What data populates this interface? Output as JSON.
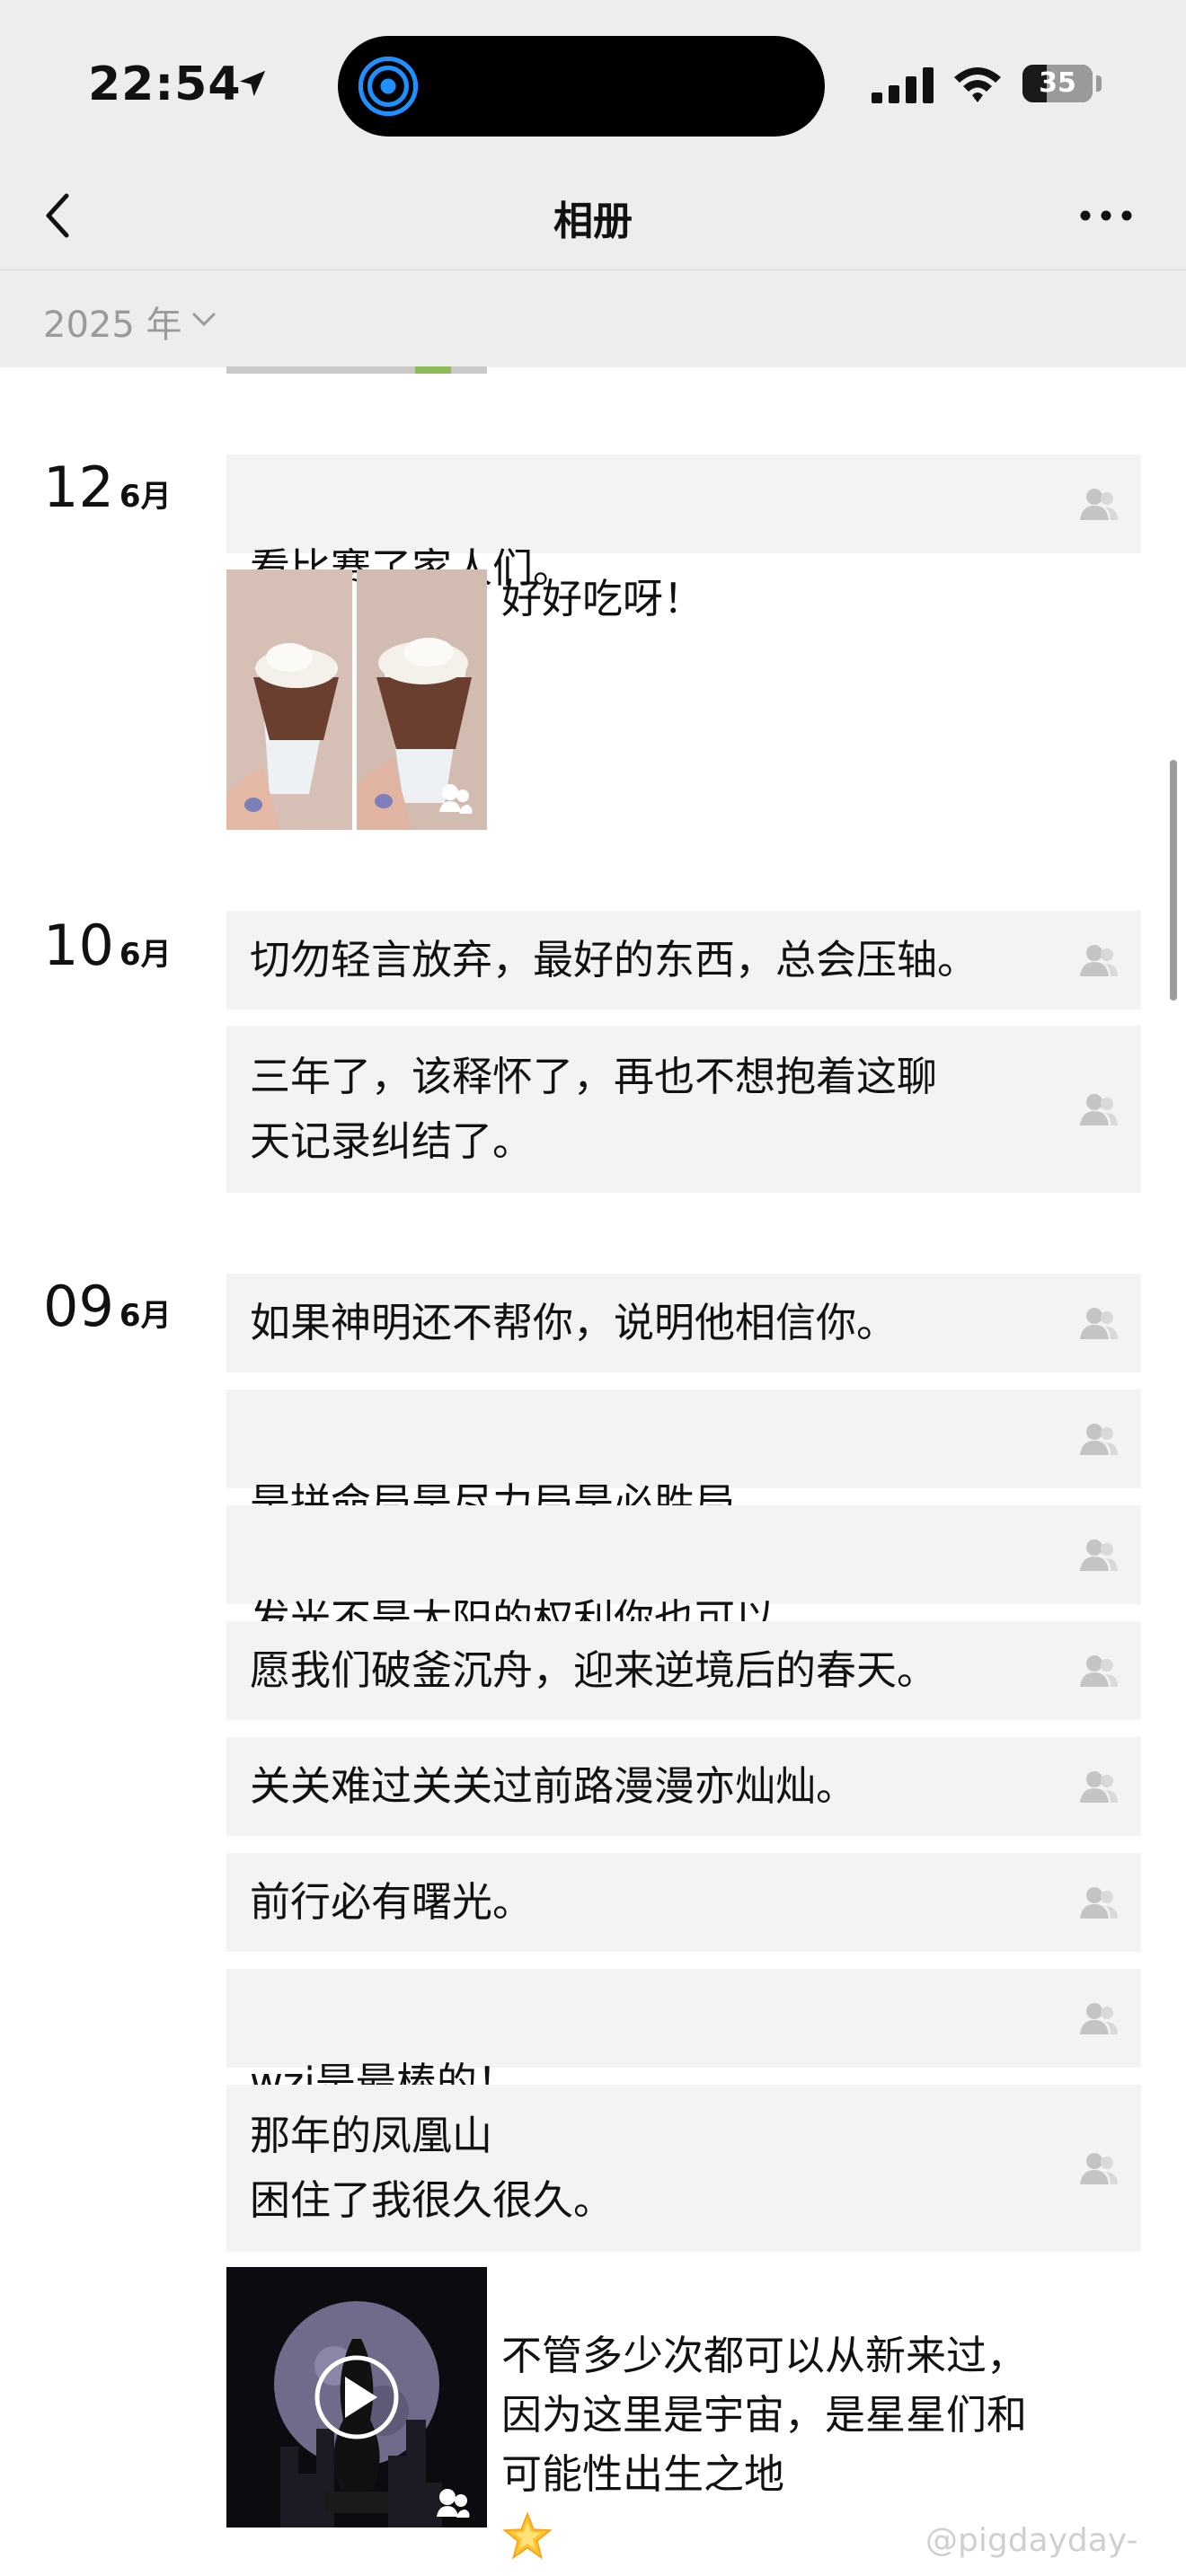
{
  "status_bar": {
    "time": "22:54",
    "battery": "35"
  },
  "nav": {
    "title": "相册"
  },
  "year_filter": {
    "label": "2025 年"
  },
  "days": [
    {
      "day": "12",
      "month": "6月",
      "posts": [
        {
          "text": "看比赛了家人们。"
        },
        {
          "caption": "好好吃呀！"
        }
      ]
    },
    {
      "day": "10",
      "month": "6月",
      "posts": [
        {
          "text": "切勿轻言放弃，最好的东西，总会压轴。"
        },
        {
          "text": "三年了，该释怀了，再也不想抱着这聊\n天记录纠结了。"
        }
      ]
    },
    {
      "day": "09",
      "month": "6月",
      "posts": [
        {
          "text": "如果神明还不帮你，说明他相信你。"
        },
        {
          "text": "是拼命局是尽力局是必胜局"
        },
        {
          "text": "发光不是太阳的权利你也可以"
        },
        {
          "text": "愿我们破釜沉舟，迎来逆境后的春天。"
        },
        {
          "text": "关关难过关关过前路漫漫亦灿灿。"
        },
        {
          "text": "前行必有曙光。"
        },
        {
          "text": "wzj是最棒的！"
        },
        {
          "text": "那年的凤凰山\n困住了我很久很久。"
        },
        {
          "caption": "不管多少次都可以从新来过，\n因为这里是宇宙，是星星们和\n可能性出生之地"
        }
      ]
    }
  ],
  "watermark": "@pigdayday-",
  "colors": {
    "header_bg": "#ededed",
    "post_bg": "#f3f3f3",
    "secondary_text": "#9a9a9a",
    "island_icon": "#1e90ff"
  }
}
